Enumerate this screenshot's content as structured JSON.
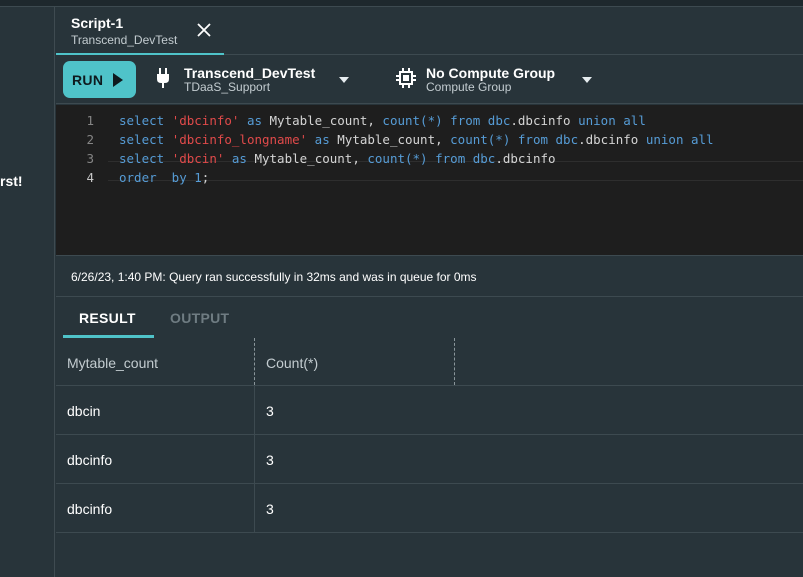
{
  "left_pane": {
    "fragment": "rst!"
  },
  "tab": {
    "title": "Script-1",
    "subtitle": "Transcend_DevTest"
  },
  "toolbar": {
    "run_label": "RUN",
    "connection": {
      "title": "Transcend_DevTest",
      "subtitle": "TDaaS_Support"
    },
    "compute": {
      "title": "No Compute Group",
      "subtitle": "Compute Group"
    }
  },
  "editor": {
    "lines": [
      {
        "number": "1",
        "tokens": [
          {
            "t": "select ",
            "c": "kw"
          },
          {
            "t": "'dbcinfo'",
            "c": "str"
          },
          {
            "t": " as ",
            "c": "kw"
          },
          {
            "t": "Mytable_count, ",
            "c": "txt"
          },
          {
            "t": "count(*)",
            "c": "kw"
          },
          {
            "t": " from ",
            "c": "kw"
          },
          {
            "t": "dbc",
            "c": "kw"
          },
          {
            "t": ".dbcinfo ",
            "c": "txt"
          },
          {
            "t": "union all",
            "c": "kw"
          }
        ]
      },
      {
        "number": "2",
        "tokens": [
          {
            "t": "select ",
            "c": "kw"
          },
          {
            "t": "'dbcinfo_longname'",
            "c": "str"
          },
          {
            "t": " as ",
            "c": "kw"
          },
          {
            "t": "Mytable_count, ",
            "c": "txt"
          },
          {
            "t": "count(*)",
            "c": "kw"
          },
          {
            "t": " from ",
            "c": "kw"
          },
          {
            "t": "dbc",
            "c": "kw"
          },
          {
            "t": ".dbcinfo ",
            "c": "txt"
          },
          {
            "t": "union all",
            "c": "kw"
          }
        ]
      },
      {
        "number": "3",
        "tokens": [
          {
            "t": "select ",
            "c": "kw"
          },
          {
            "t": "'dbcin'",
            "c": "str"
          },
          {
            "t": " as ",
            "c": "kw"
          },
          {
            "t": "Mytable_count, ",
            "c": "txt"
          },
          {
            "t": "count(*)",
            "c": "kw"
          },
          {
            "t": " from ",
            "c": "kw"
          },
          {
            "t": "dbc",
            "c": "kw"
          },
          {
            "t": ".dbcinfo",
            "c": "txt"
          }
        ]
      },
      {
        "number": "4",
        "tokens": [
          {
            "t": "order  by ",
            "c": "kw"
          },
          {
            "t": "1",
            "c": "kw"
          },
          {
            "t": ";",
            "c": "txt"
          }
        ]
      }
    ]
  },
  "status": {
    "message": "6/26/23, 1:40 PM: Query ran successfully in 32ms and was in queue for 0ms"
  },
  "result_tabs": {
    "result": "RESULT",
    "output": "OUTPUT"
  },
  "grid": {
    "columns": [
      "Mytable_count",
      "Count(*)"
    ],
    "rows": [
      [
        "dbcin",
        "3"
      ],
      [
        "dbcinfo",
        "3"
      ],
      [
        "dbcinfo",
        "3"
      ]
    ]
  },
  "colors": {
    "accent": "#4fc3c9",
    "keyword": "#569cd6",
    "string": "#e04a4a",
    "background": "#28343a",
    "editor_bg": "#1e1e1e"
  },
  "icons": {
    "close": "close-icon",
    "run": "play-icon",
    "connection": "plug-icon",
    "compute": "compute-chip-icon",
    "dropdown": "chevron-down-icon"
  }
}
